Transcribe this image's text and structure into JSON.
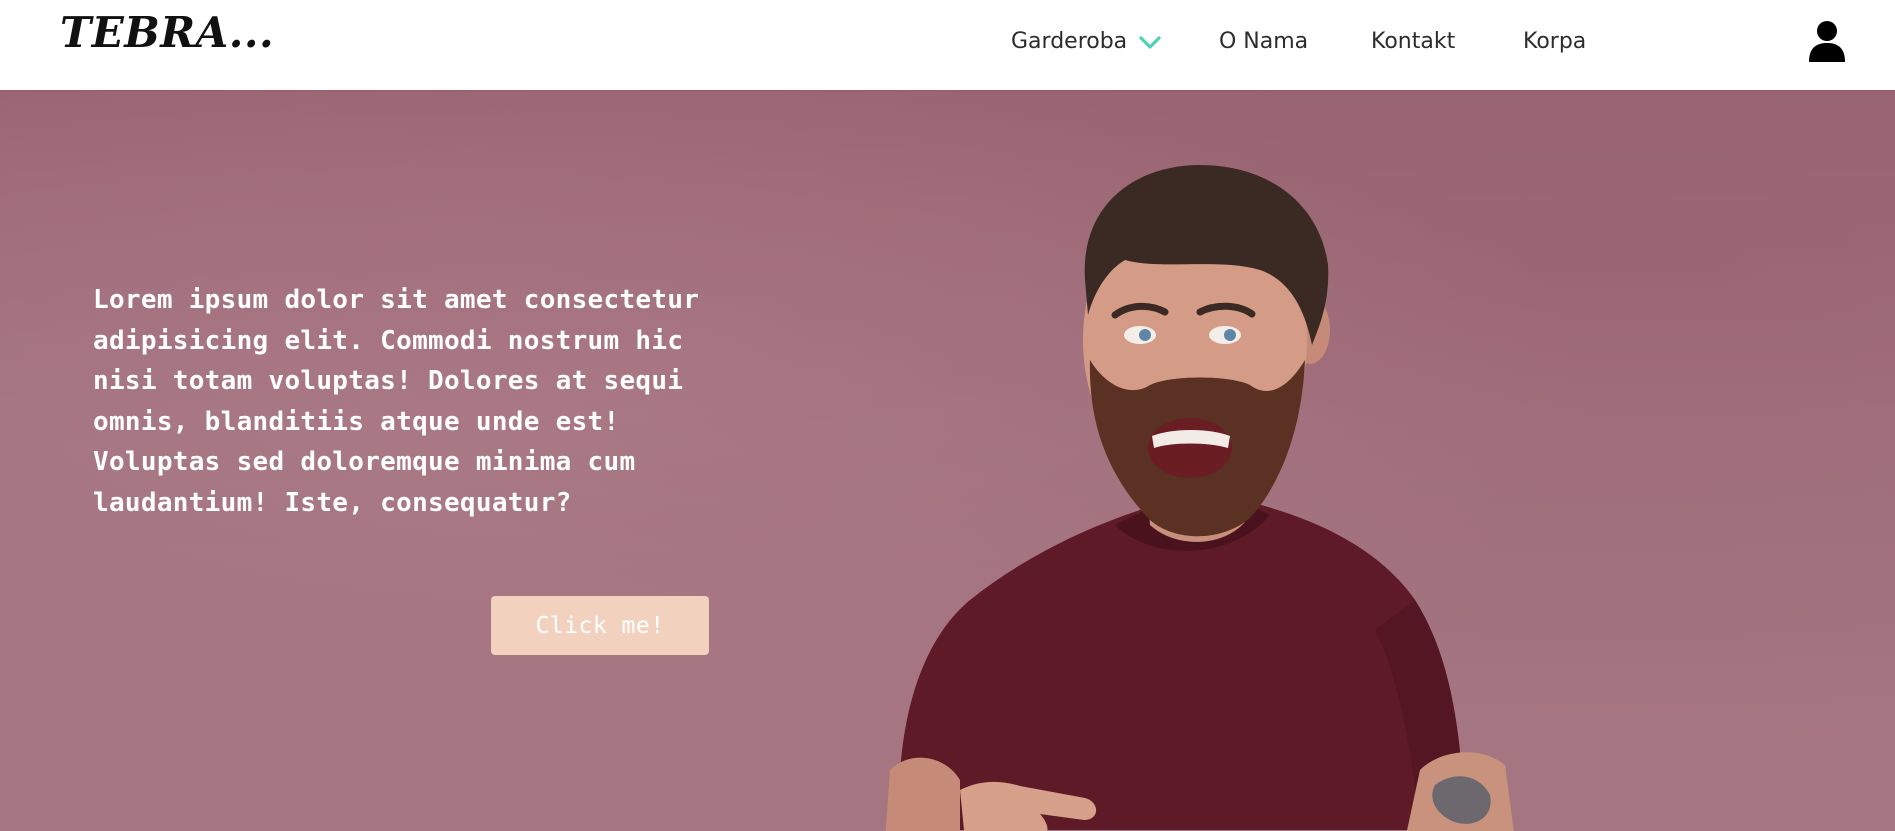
{
  "header": {
    "logo_text": "TEBRA...",
    "nav": {
      "items": [
        {
          "label": "Garderoba",
          "has_dropdown": true
        },
        {
          "label": "O Nama"
        },
        {
          "label": "Kontakt"
        },
        {
          "label": "Korpa"
        }
      ]
    },
    "icons": {
      "dropdown": "chevron-down-icon",
      "account": "user-icon"
    }
  },
  "hero": {
    "text": "Lorem ipsum dolor sit amet consectetur adipisicing elit. Commodi nostrum hic nisi totam voluptas! Dolores at sequi omnis, blanditiis atque unde est! Voluptas sed doloremque minima cum laudantium! Iste, consequatur?",
    "button_label": "Click me!",
    "image": "smiling bearded man in maroon t-shirt pointing at himself"
  },
  "colors": {
    "header_bg": "#ffffff",
    "hero_bg": "#a06f7b",
    "accent": "#4fd1b5",
    "button_bg": "#f2d2bf",
    "text_light": "#ffffff",
    "text_dark": "#2c2c2c"
  }
}
